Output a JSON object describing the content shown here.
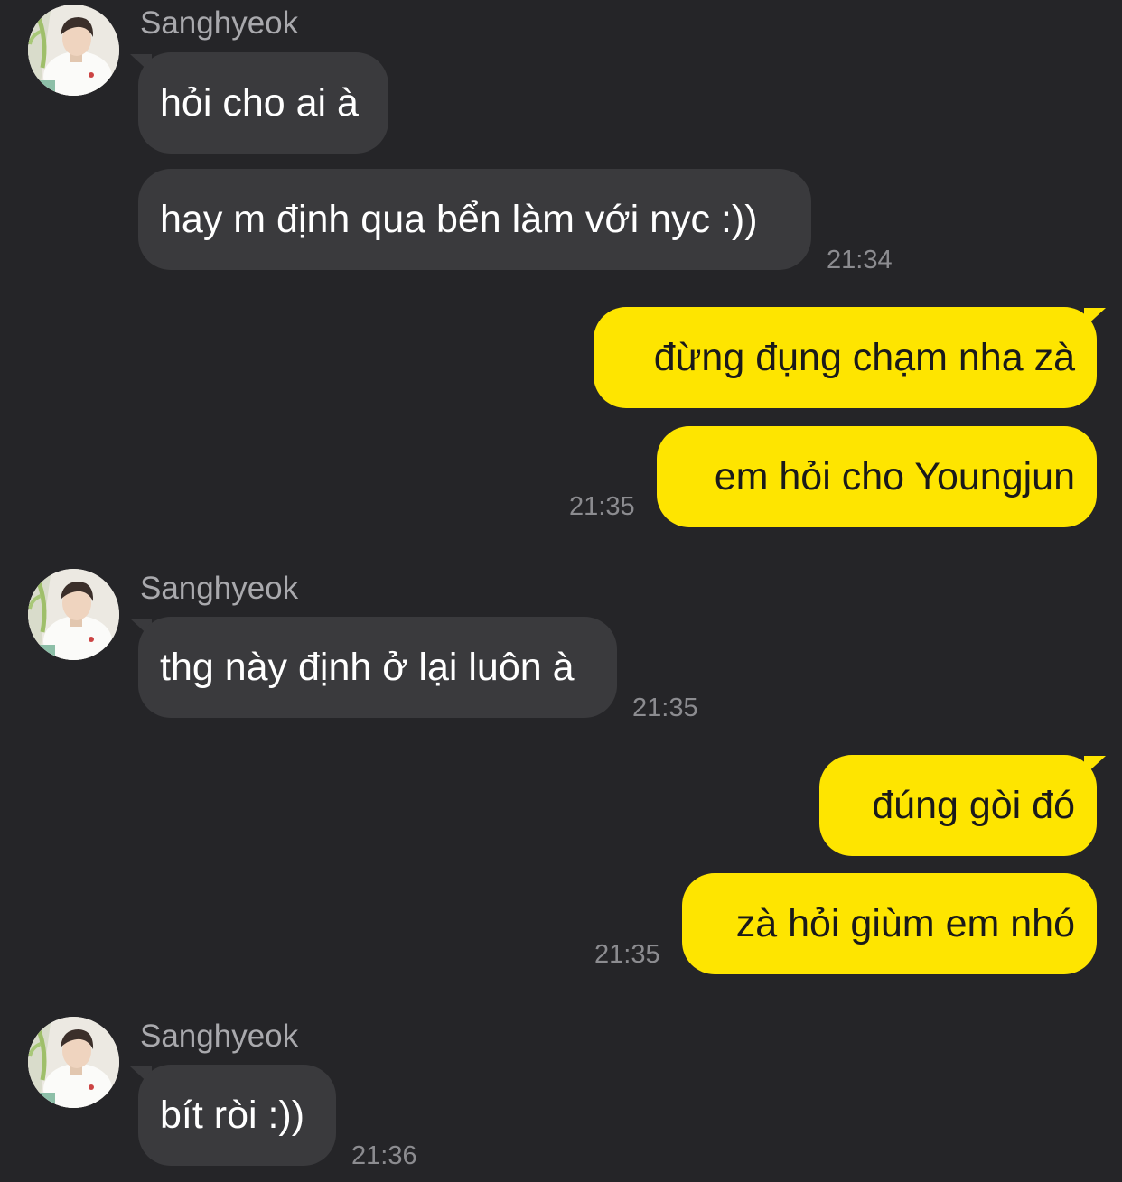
{
  "colors": {
    "background": "#252528",
    "incoming_bubble": "#3a3a3d",
    "outgoing_bubble": "#fee500",
    "sender_name": "#a9a9ad",
    "timestamp": "#8c8c90"
  },
  "messages": {
    "group1": {
      "sender": "Sanghyeok",
      "avatar_icon": "profile-photo",
      "bubbles": [
        "hỏi cho ai à",
        "hay m định qua bển làm với nyc :))"
      ],
      "time": "21:34"
    },
    "group2": {
      "bubbles": [
        "đừng đụng chạm nha zà",
        "em hỏi cho Youngjun"
      ],
      "time": "21:35"
    },
    "group3": {
      "sender": "Sanghyeok",
      "avatar_icon": "profile-photo",
      "bubbles": [
        "thg này định ở lại luôn à"
      ],
      "time": "21:35"
    },
    "group4": {
      "bubbles": [
        "đúng gòi đó",
        "zà hỏi giùm em nhó"
      ],
      "time": "21:35"
    },
    "group5": {
      "sender": "Sanghyeok",
      "avatar_icon": "profile-photo",
      "bubbles": [
        "bít ròi :))"
      ],
      "time": "21:36"
    }
  }
}
